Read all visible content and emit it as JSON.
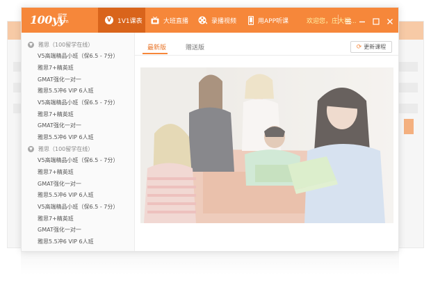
{
  "app": {
    "logo_main": "100yy",
    "logo_sub_line1": "留学",
    "logo_sub_line2": ".com"
  },
  "nav": [
    {
      "label": "1V1课表",
      "icon": "v-circle-icon",
      "active": true
    },
    {
      "label": "大班直播",
      "icon": "tv-icon",
      "active": false
    },
    {
      "label": "录播视频",
      "icon": "film-reel-icon",
      "active": false
    },
    {
      "label": "用APP听课",
      "icon": "phone-icon",
      "active": false
    }
  ],
  "header": {
    "welcome": "欢迎您，庄大祠..."
  },
  "sidebar": {
    "groups": [
      {
        "title": "雅思（100留学在线）",
        "items": [
          "V5高端精品小班（保6.5 - 7分）",
          "雅思7+精英班",
          "GMAT强化一对一",
          "雅思5.5冲6 VIP 6人班",
          "V5高端精品小班（保6.5 - 7分）",
          "雅思7+精英班",
          "GMAT强化一对一",
          "雅思5.5冲6 VIP 6人班"
        ]
      },
      {
        "title": "雅思（100留学在线）",
        "items": [
          "V5高端精品小班（保6.5 - 7分）",
          "雅思7+精英班",
          "GMAT强化一对一",
          "雅思5.5冲6 VIP 6人班",
          "V5高端精品小班（保6.5 - 7分）",
          "雅思7+精英班",
          "GMAT强化一对一",
          "雅思5.5冲6 VIP 6人班"
        ]
      }
    ]
  },
  "tabs": [
    {
      "label": "最新版",
      "active": true
    },
    {
      "label": "赠送版",
      "active": false
    }
  ],
  "refresh_button": {
    "label": "更新课程",
    "icon": "refresh-icon"
  },
  "colors": {
    "accent": "#f6873a",
    "accent_dark": "#d9641b",
    "welcome_text": "#fff4a8"
  }
}
